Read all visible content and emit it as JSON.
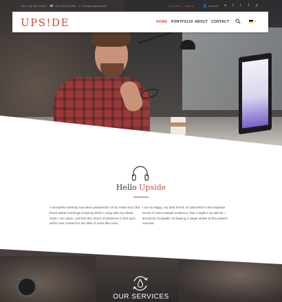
{
  "topbar": {
    "questions": "Have any Questions?",
    "phone": "+01 123 444 555",
    "email": "info@company.com",
    "links": [
      "Company",
      "Support"
    ],
    "account": "Account"
  },
  "nav": {
    "logo": "UPS!DE",
    "items": [
      "HOME",
      "PORTFOLIO",
      "ABOUT",
      "CONTACT"
    ],
    "active_index": 0,
    "language_flag": "de-flag-icon"
  },
  "hello": {
    "title_plain": "Hello",
    "title_accent": "Upside",
    "left_text": "A wonderful serenity has taken possession of my entire soul, like these sweet mornings of spring which I enjoy with my whole heart. I am alone, and feel the charm of existence in this spot, which was created for the bliss of souls like mine.",
    "right_text": "I am so happy, my dear friend, so absorbed in the exquisite sense of mere tranquil existence, that I neglect my talents. I should be incapable of drawing a single stroke at the present moment."
  },
  "services": {
    "title": "OUR SERVICES"
  },
  "colors": {
    "accent": "#c84b3a",
    "text": "#333333",
    "muted": "#9a9a9a"
  }
}
